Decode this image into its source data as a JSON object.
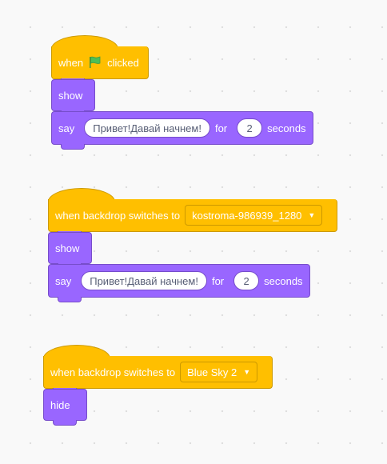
{
  "colors": {
    "events": "#ffbf00",
    "events_border": "#cc9900",
    "looks": "#9966ff",
    "looks_border": "#774dcb",
    "canvas": "#f9f9f9"
  },
  "script1": {
    "hat_label_when": "when",
    "hat_icon": "green-flag-icon",
    "hat_label_clicked": "clicked",
    "show_label": "show",
    "say_label": "say",
    "say_message": "Привет!Давай начнем!",
    "for_label": "for",
    "seconds_value": "2",
    "seconds_label": "seconds"
  },
  "script2": {
    "hat_label": "when backdrop switches to",
    "backdrop_value": "kostroma-986939_1280",
    "show_label": "show",
    "say_label": "say",
    "say_message": "Привет!Давай начнем!",
    "for_label": "for",
    "seconds_value": "2",
    "seconds_label": "seconds"
  },
  "script3": {
    "hat_label": "when backdrop switches to",
    "backdrop_value": "Blue Sky 2",
    "hide_label": "hide"
  }
}
